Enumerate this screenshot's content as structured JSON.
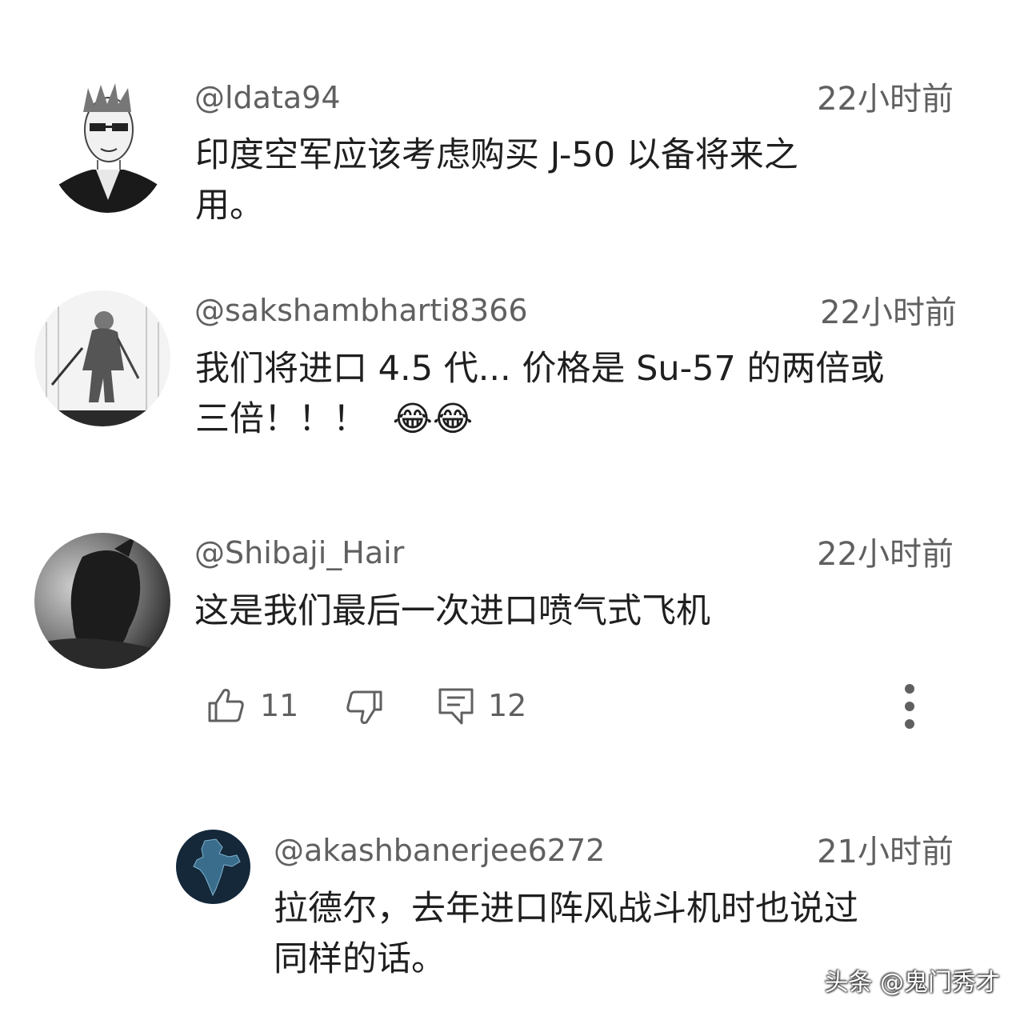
{
  "comments": [
    {
      "username": "@ldata94",
      "time": "22小时前",
      "text_line1": "印度空军应该考虑购买 J-50 以备将来之",
      "text_line2": "用。",
      "avatar": "sketch-man-with-glasses"
    },
    {
      "username": "@sakshambharti8366",
      "time": "22小时前",
      "text_line1": "我们将进口 4.5 代... 价格是 Su-57 的两倍或",
      "text_line2": "三倍！！！",
      "emoji": "😂😂",
      "avatar": "samurai-sketch"
    },
    {
      "username": "@Shibaji_Hair",
      "time": "22小时前",
      "text_line1": "这是我们最后一次进口喷气式飞机",
      "avatar": "dark-figure"
    }
  ],
  "actions": {
    "like_count": "11",
    "reply_count": "12"
  },
  "reply": {
    "username": "@akashbanerjee6272",
    "time": "21小时前",
    "text_line1": "拉德尔，去年进口阵风战斗机时也说过",
    "text_line2": "同样的话。",
    "avatar": "india-map"
  },
  "watermark": "头条 @鬼门秀才",
  "colors": {
    "meta": "#606060",
    "text": "#1f1f1f",
    "background": "#ffffff"
  }
}
